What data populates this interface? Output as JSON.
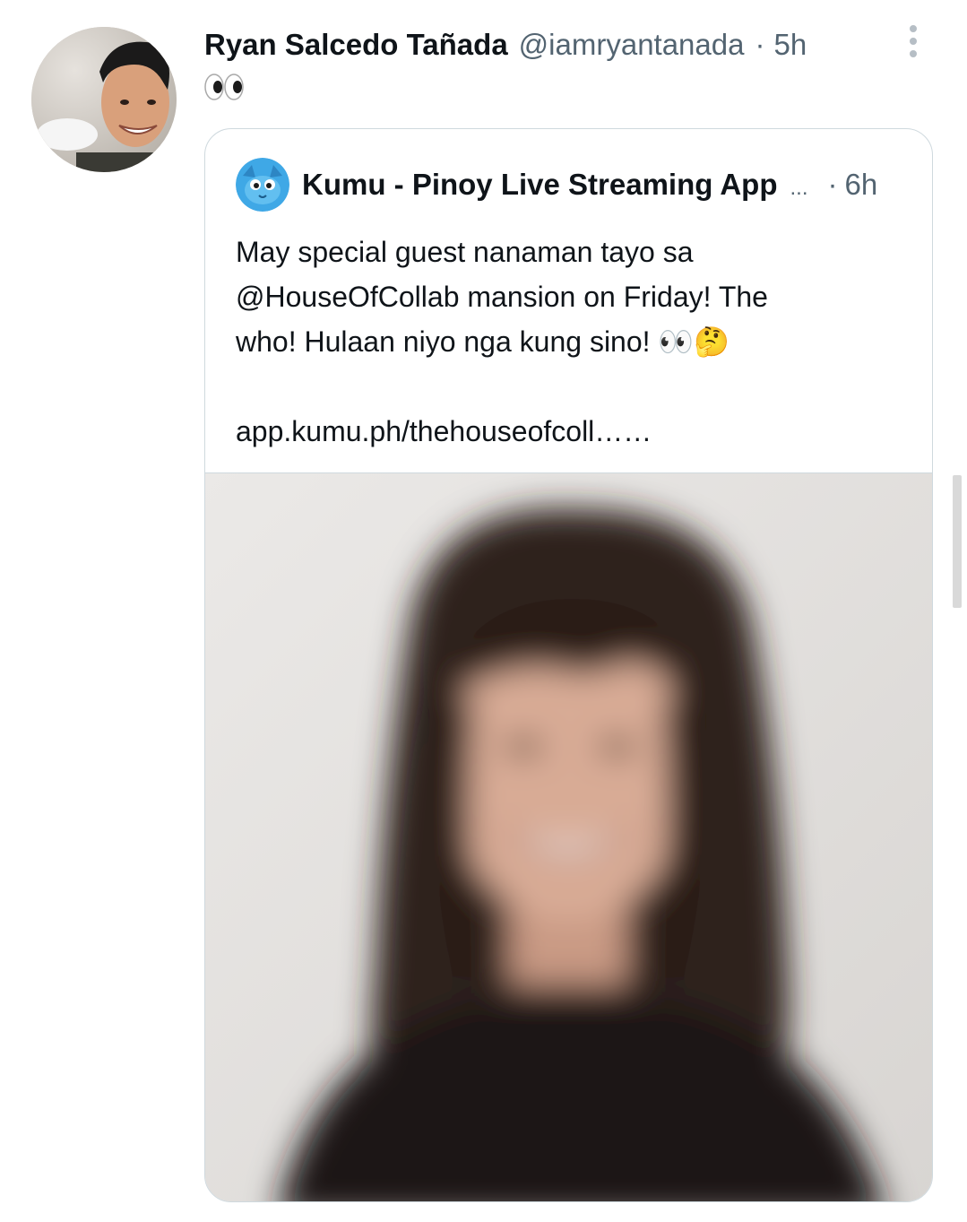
{
  "tweet": {
    "author_name": "Ryan Salcedo Tañada",
    "author_handle": "@iamryantanada",
    "separator": "·",
    "time": "5h",
    "text_icon": "eyes-emoji"
  },
  "quote": {
    "author_name": "Kumu - Pinoy Live Streaming App",
    "truncation": "...",
    "separator": "·",
    "time": "6h",
    "text_lines": [
      "May special guest nanaman tayo sa",
      "@HouseOfCollab  mansion on Friday! The",
      "who! Hulaan niyo nga kung sino! 👀🤔"
    ],
    "link": "app.kumu.ph/thehouseofcoll……"
  },
  "icons": {
    "more": "more-vertical-icon",
    "avatar_kumu": "kumu-logo-icon"
  },
  "colors": {
    "text": "#0f1419",
    "secondary": "#536471",
    "border": "#cfd9de",
    "kumu_blue": "#3fa8e6"
  }
}
